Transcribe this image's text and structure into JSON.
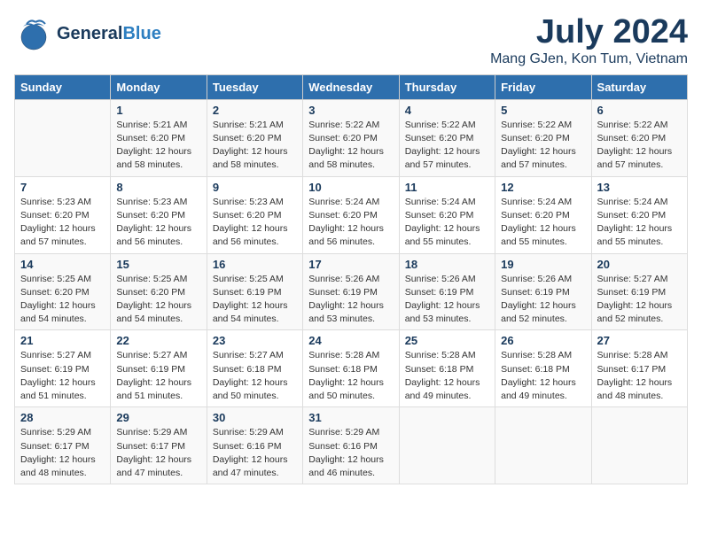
{
  "header": {
    "title": "July 2024",
    "subtitle": "Mang GJen, Kon Tum, Vietnam",
    "logo_line1": "General",
    "logo_line2": "Blue"
  },
  "days_of_week": [
    "Sunday",
    "Monday",
    "Tuesday",
    "Wednesday",
    "Thursday",
    "Friday",
    "Saturday"
  ],
  "weeks": [
    [
      {
        "day": "",
        "info": ""
      },
      {
        "day": "1",
        "info": "Sunrise: 5:21 AM\nSunset: 6:20 PM\nDaylight: 12 hours\nand 58 minutes."
      },
      {
        "day": "2",
        "info": "Sunrise: 5:21 AM\nSunset: 6:20 PM\nDaylight: 12 hours\nand 58 minutes."
      },
      {
        "day": "3",
        "info": "Sunrise: 5:22 AM\nSunset: 6:20 PM\nDaylight: 12 hours\nand 58 minutes."
      },
      {
        "day": "4",
        "info": "Sunrise: 5:22 AM\nSunset: 6:20 PM\nDaylight: 12 hours\nand 57 minutes."
      },
      {
        "day": "5",
        "info": "Sunrise: 5:22 AM\nSunset: 6:20 PM\nDaylight: 12 hours\nand 57 minutes."
      },
      {
        "day": "6",
        "info": "Sunrise: 5:22 AM\nSunset: 6:20 PM\nDaylight: 12 hours\nand 57 minutes."
      }
    ],
    [
      {
        "day": "7",
        "info": "Sunrise: 5:23 AM\nSunset: 6:20 PM\nDaylight: 12 hours\nand 57 minutes."
      },
      {
        "day": "8",
        "info": "Sunrise: 5:23 AM\nSunset: 6:20 PM\nDaylight: 12 hours\nand 56 minutes."
      },
      {
        "day": "9",
        "info": "Sunrise: 5:23 AM\nSunset: 6:20 PM\nDaylight: 12 hours\nand 56 minutes."
      },
      {
        "day": "10",
        "info": "Sunrise: 5:24 AM\nSunset: 6:20 PM\nDaylight: 12 hours\nand 56 minutes."
      },
      {
        "day": "11",
        "info": "Sunrise: 5:24 AM\nSunset: 6:20 PM\nDaylight: 12 hours\nand 55 minutes."
      },
      {
        "day": "12",
        "info": "Sunrise: 5:24 AM\nSunset: 6:20 PM\nDaylight: 12 hours\nand 55 minutes."
      },
      {
        "day": "13",
        "info": "Sunrise: 5:24 AM\nSunset: 6:20 PM\nDaylight: 12 hours\nand 55 minutes."
      }
    ],
    [
      {
        "day": "14",
        "info": "Sunrise: 5:25 AM\nSunset: 6:20 PM\nDaylight: 12 hours\nand 54 minutes."
      },
      {
        "day": "15",
        "info": "Sunrise: 5:25 AM\nSunset: 6:20 PM\nDaylight: 12 hours\nand 54 minutes."
      },
      {
        "day": "16",
        "info": "Sunrise: 5:25 AM\nSunset: 6:19 PM\nDaylight: 12 hours\nand 54 minutes."
      },
      {
        "day": "17",
        "info": "Sunrise: 5:26 AM\nSunset: 6:19 PM\nDaylight: 12 hours\nand 53 minutes."
      },
      {
        "day": "18",
        "info": "Sunrise: 5:26 AM\nSunset: 6:19 PM\nDaylight: 12 hours\nand 53 minutes."
      },
      {
        "day": "19",
        "info": "Sunrise: 5:26 AM\nSunset: 6:19 PM\nDaylight: 12 hours\nand 52 minutes."
      },
      {
        "day": "20",
        "info": "Sunrise: 5:27 AM\nSunset: 6:19 PM\nDaylight: 12 hours\nand 52 minutes."
      }
    ],
    [
      {
        "day": "21",
        "info": "Sunrise: 5:27 AM\nSunset: 6:19 PM\nDaylight: 12 hours\nand 51 minutes."
      },
      {
        "day": "22",
        "info": "Sunrise: 5:27 AM\nSunset: 6:19 PM\nDaylight: 12 hours\nand 51 minutes."
      },
      {
        "day": "23",
        "info": "Sunrise: 5:27 AM\nSunset: 6:18 PM\nDaylight: 12 hours\nand 50 minutes."
      },
      {
        "day": "24",
        "info": "Sunrise: 5:28 AM\nSunset: 6:18 PM\nDaylight: 12 hours\nand 50 minutes."
      },
      {
        "day": "25",
        "info": "Sunrise: 5:28 AM\nSunset: 6:18 PM\nDaylight: 12 hours\nand 49 minutes."
      },
      {
        "day": "26",
        "info": "Sunrise: 5:28 AM\nSunset: 6:18 PM\nDaylight: 12 hours\nand 49 minutes."
      },
      {
        "day": "27",
        "info": "Sunrise: 5:28 AM\nSunset: 6:17 PM\nDaylight: 12 hours\nand 48 minutes."
      }
    ],
    [
      {
        "day": "28",
        "info": "Sunrise: 5:29 AM\nSunset: 6:17 PM\nDaylight: 12 hours\nand 48 minutes."
      },
      {
        "day": "29",
        "info": "Sunrise: 5:29 AM\nSunset: 6:17 PM\nDaylight: 12 hours\nand 47 minutes."
      },
      {
        "day": "30",
        "info": "Sunrise: 5:29 AM\nSunset: 6:16 PM\nDaylight: 12 hours\nand 47 minutes."
      },
      {
        "day": "31",
        "info": "Sunrise: 5:29 AM\nSunset: 6:16 PM\nDaylight: 12 hours\nand 46 minutes."
      },
      {
        "day": "",
        "info": ""
      },
      {
        "day": "",
        "info": ""
      },
      {
        "day": "",
        "info": ""
      }
    ]
  ]
}
